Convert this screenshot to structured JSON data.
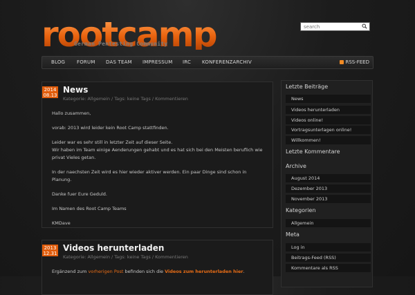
{
  "header": {
    "logo_text": "rootcamp",
    "logo_subtitle": "German Pentesting Community",
    "search_placeholder": "search"
  },
  "nav": {
    "items": [
      "BLOG",
      "FORUM",
      "DAS TEAM",
      "IMPRESSUM",
      "IRC",
      "KONFERENZARCHIV"
    ],
    "rss_label": "RSS-FEED"
  },
  "posts": [
    {
      "date_year": "2014",
      "date_day": "08.13",
      "title": "News",
      "meta": "Kategorie: Allgemein / Tags: keine Tags / Kommentieren",
      "paragraphs": [
        "Hallo zusammen,",
        "vorab: 2013 wird leider kein Root Camp stattfinden.",
        "Leider war es sehr still in letzter Zeit auf dieser Seite.",
        "Wir haben im Team einige Aenderungen gehabt und es hat sich bei den Meisten beruflich wie privat Vieles getan.",
        "In der naechsten Zeit wird es hier wieder aktiver werden. Ein paar Dinge sind schon in Planung.",
        "Danke fuer Eure Geduld.",
        "Im Namen des Root Camp Teams",
        "KMDave"
      ]
    },
    {
      "date_year": "2013",
      "date_day": "12.31",
      "title": "Videos herunterladen",
      "meta": "Kategorie: Allgemein / Tags: keine Tags / Kommentieren",
      "text_part1": "Ergänzend zum ",
      "link1": "vorherigen Post",
      "text_part2": " befinden sich die ",
      "link2": "Videos zum herunterladen hier",
      "text_part3": "."
    }
  ],
  "sidebar": {
    "recent_posts_title": "Letzte Beiträge",
    "recent_posts": [
      "News",
      "Videos herunterladen",
      "Videos online!",
      "Vortragsunterlagen online!",
      "Willkommen!"
    ],
    "recent_comments_title": "Letzte Kommentare",
    "archive_title": "Archive",
    "archive": [
      "August 2014",
      "Dezember 2013",
      "November 2013"
    ],
    "categories_title": "Kategorien",
    "categories": [
      "Allgemein"
    ],
    "meta_title": "Meta",
    "meta": [
      "Log in",
      "Beitrags-Feed (RSS)",
      "Kommentare als RSS"
    ]
  }
}
